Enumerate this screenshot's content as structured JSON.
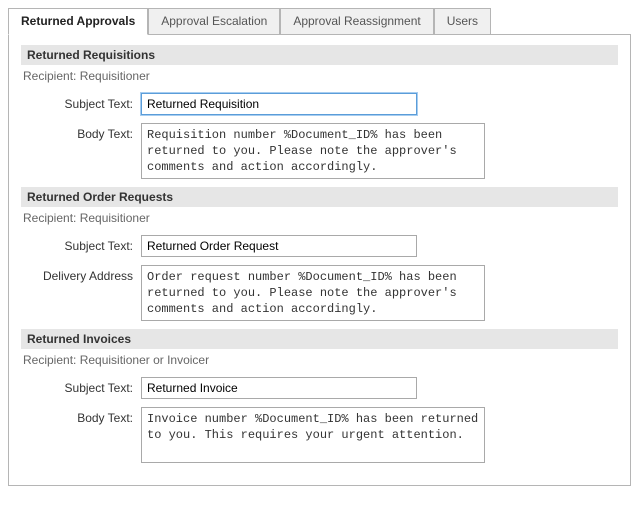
{
  "tabs": [
    {
      "label": "Returned Approvals",
      "active": true
    },
    {
      "label": "Approval Escalation",
      "active": false
    },
    {
      "label": "Approval Reassignment",
      "active": false
    },
    {
      "label": "Users",
      "active": false
    }
  ],
  "labels": {
    "recipient_prefix": "Recipient: ",
    "subject_text": "Subject Text:",
    "body_text": "Body Text:",
    "delivery_address": "Delivery Address"
  },
  "sections": {
    "requisitions": {
      "header": "Returned Requisitions",
      "recipient": "Requisitioner",
      "subject_value": "Returned Requisition",
      "body_value": "Requisition number %Document_ID% has been returned to you. Please note the approver's comments and action accordingly."
    },
    "order_requests": {
      "header": "Returned Order Requests",
      "recipient": "Requisitioner",
      "subject_value": "Returned Order Request",
      "body_value": "Order request number %Document_ID% has been returned to you. Please note the approver's comments and action accordingly."
    },
    "invoices": {
      "header": "Returned Invoices",
      "recipient": "Requisitioner or Invoicer",
      "subject_value": "Returned Invoice",
      "body_value": "Invoice number %Document_ID% has been returned to you. This requires your urgent attention."
    }
  }
}
